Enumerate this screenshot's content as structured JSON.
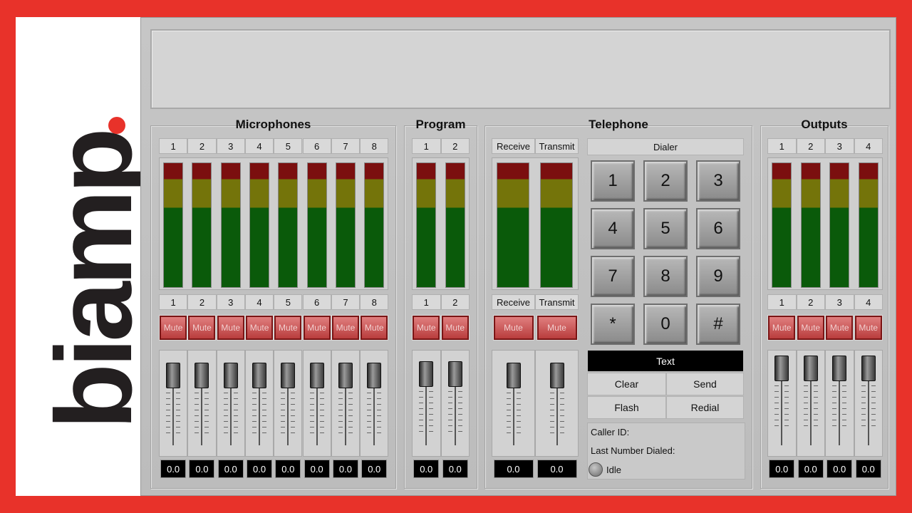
{
  "logo": {
    "text": "biamp"
  },
  "sections": {
    "microphones": "Microphones",
    "program": "Program",
    "telephone": "Telephone",
    "outputs": "Outputs"
  },
  "microphones": {
    "channels": [
      "1",
      "2",
      "3",
      "4",
      "5",
      "6",
      "7",
      "8"
    ],
    "mute_label": "Mute",
    "values": [
      "0.0",
      "0.0",
      "0.0",
      "0.0",
      "0.0",
      "0.0",
      "0.0",
      "0.0"
    ]
  },
  "program": {
    "channels": [
      "1",
      "2"
    ],
    "mute_label": "Mute",
    "values": [
      "0.0",
      "0.0"
    ]
  },
  "telephone": {
    "channels": [
      "Receive",
      "Transmit"
    ],
    "mute_label": "Mute",
    "values": [
      "0.0",
      "0.0"
    ],
    "dialer_label": "Dialer",
    "keys": [
      "1",
      "2",
      "3",
      "4",
      "5",
      "6",
      "7",
      "8",
      "9",
      "*",
      "0",
      "#"
    ],
    "text_field": "Text",
    "clear_label": "Clear",
    "send_label": "Send",
    "flash_label": "Flash",
    "redial_label": "Redial",
    "caller_id_label": "Caller ID:",
    "last_number_label": "Last Number Dialed:",
    "status": "Idle"
  },
  "outputs": {
    "channels": [
      "1",
      "2",
      "3",
      "4"
    ],
    "mute_label": "Mute",
    "values": [
      "0.0",
      "0.0",
      "0.0",
      "0.0"
    ]
  },
  "colors": {
    "frame": "#e8322a",
    "meter_red": "#7b0f0f",
    "meter_yellow": "#74740a",
    "meter_green": "#0a5a0a",
    "mute": "#b93d3d"
  }
}
